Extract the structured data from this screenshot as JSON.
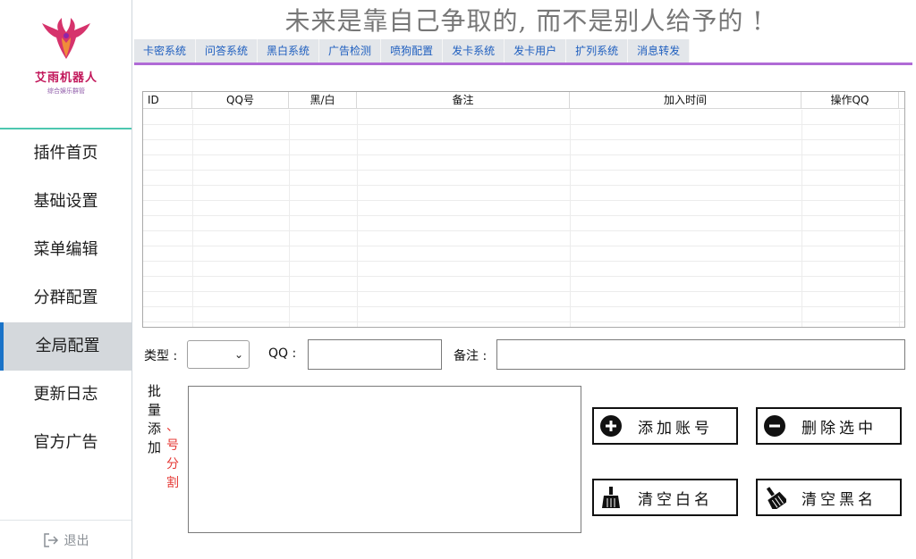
{
  "logo": {
    "title": "艾雨机器人",
    "subtitle": "综合娱乐群管"
  },
  "banner": "未来是靠自己争取的, 而不是别人给予的 !",
  "tabs": [
    "卡密系统",
    "问答系统",
    "黑白系统",
    "广告检测",
    "喷狗配置",
    "发卡系统",
    "发卡用户",
    "扩列系统",
    "消息转发"
  ],
  "menu": [
    "插件首页",
    "基础设置",
    "菜单编辑",
    "分群配置",
    "全局配置",
    "更新日志",
    "官方广告"
  ],
  "active_menu": "全局配置",
  "logout": "退出",
  "grid": {
    "columns": [
      "ID",
      "QQ号",
      "黑/白",
      "备注",
      "加入时间",
      "操作QQ"
    ]
  },
  "form": {
    "type_label": "类型 :",
    "qq_label": "QQ :",
    "note_label": "备注 :",
    "type_value": ""
  },
  "batch": {
    "label": "批量添加",
    "hint": "、号分割"
  },
  "buttons": {
    "add": "添加账号",
    "delete": "删除选中",
    "clear_white": "清空白名",
    "clear_black": "清空黑名"
  },
  "colors": {
    "accent_blue": "#1a73c8",
    "tab_text": "#1f5fbf",
    "underline": "#b06bd6",
    "hint_red": "#e53935",
    "divider": "#4dc7b0"
  }
}
